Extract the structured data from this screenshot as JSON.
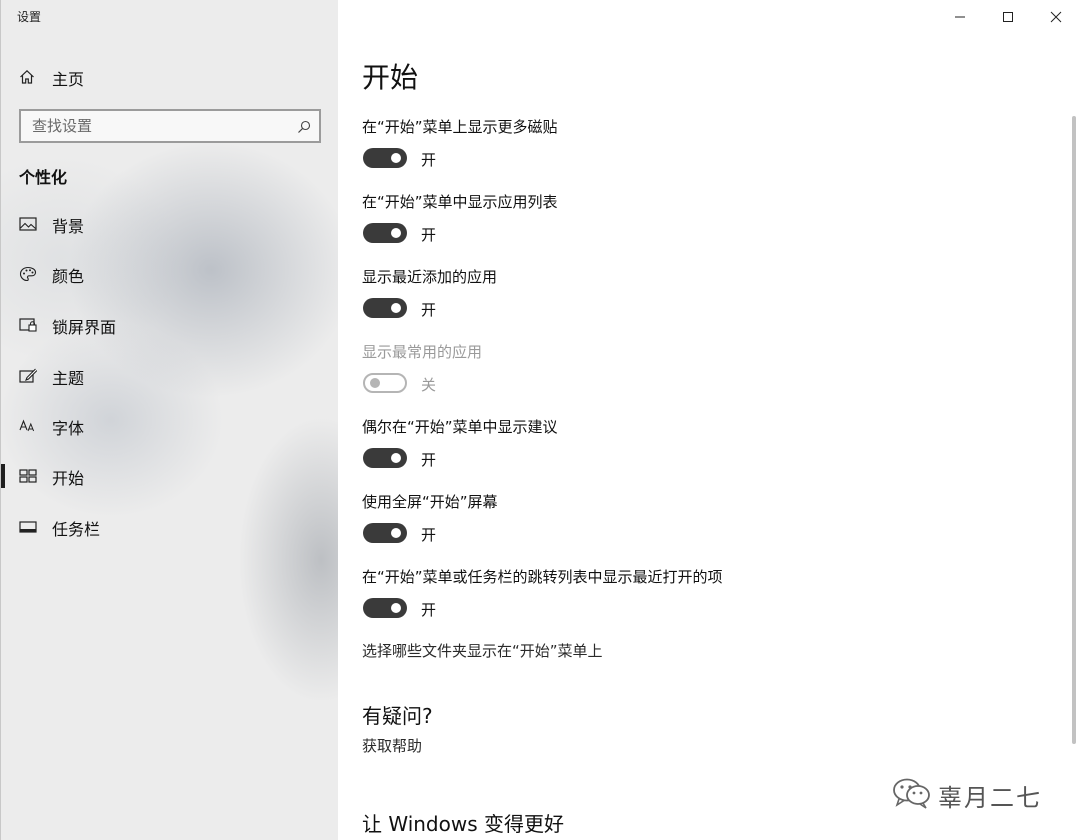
{
  "window": {
    "title": "设置"
  },
  "sidebar": {
    "home": {
      "label": "主页",
      "icon": "home-icon"
    },
    "search": {
      "placeholder": "查找设置",
      "value": "",
      "icon": "search-icon"
    },
    "section": "个性化",
    "items": [
      {
        "label": "背景",
        "icon": "picture-icon",
        "active": false
      },
      {
        "label": "颜色",
        "icon": "palette-icon",
        "active": false
      },
      {
        "label": "锁屏界面",
        "icon": "lock-screen-icon",
        "active": false
      },
      {
        "label": "主题",
        "icon": "theme-brush-icon",
        "active": false
      },
      {
        "label": "字体",
        "icon": "font-icon",
        "active": false
      },
      {
        "label": "开始",
        "icon": "start-tiles-icon",
        "active": true
      },
      {
        "label": "任务栏",
        "icon": "taskbar-icon",
        "active": false
      }
    ]
  },
  "main": {
    "title": "开始",
    "settings": [
      {
        "label": "在“开始”菜单上显示更多磁贴",
        "on": true,
        "state": "开",
        "enabled": true
      },
      {
        "label": "在“开始”菜单中显示应用列表",
        "on": true,
        "state": "开",
        "enabled": true
      },
      {
        "label": "显示最近添加的应用",
        "on": true,
        "state": "开",
        "enabled": true
      },
      {
        "label": "显示最常用的应用",
        "on": false,
        "state": "关",
        "enabled": false
      },
      {
        "label": "偶尔在“开始”菜单中显示建议",
        "on": true,
        "state": "开",
        "enabled": true
      },
      {
        "label": "使用全屏“开始”屏幕",
        "on": true,
        "state": "开",
        "enabled": true
      },
      {
        "label": "在“开始”菜单或任务栏的跳转列表中显示最近打开的项",
        "on": true,
        "state": "开",
        "enabled": true
      }
    ],
    "folders_link": "选择哪些文件夹显示在“开始”菜单上",
    "question_head": "有疑问?",
    "help_link": "获取帮助",
    "improve_head": "让 Windows 变得更好"
  },
  "watermark": {
    "text": "辜月二七",
    "icon": "wechat-icon"
  }
}
